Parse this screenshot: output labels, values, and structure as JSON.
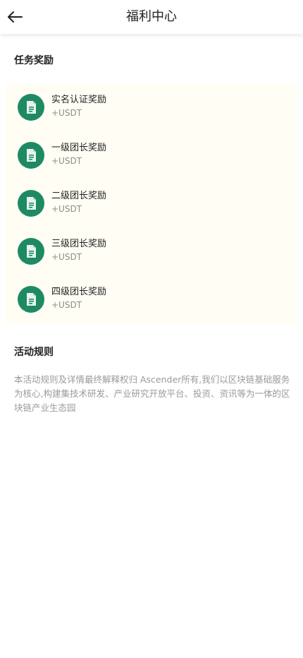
{
  "header": {
    "title": "福利中心",
    "back_icon": "arrow-left-icon"
  },
  "tasks_section": {
    "title": "任务奖励",
    "card_background": "#fffdf4",
    "icon_name": "document-icon",
    "icon_color": "#1e8a64",
    "items": [
      {
        "name": "实名认证奖励",
        "reward": "+USDT"
      },
      {
        "name": "一级团长奖励",
        "reward": "+USDT"
      },
      {
        "name": "二级团长奖励",
        "reward": "+USDT"
      },
      {
        "name": "三级团长奖励",
        "reward": "+USDT"
      },
      {
        "name": "四级团长奖励",
        "reward": "+USDT"
      }
    ]
  },
  "rules_section": {
    "title": "活动规则",
    "text": "本活动规则及详情最终解释权归 Ascender所有,我们以区块链基础服务为核心,构建集技术研发、产业研究开放平台、投资、资讯等为一体的区块链产业生态园"
  }
}
